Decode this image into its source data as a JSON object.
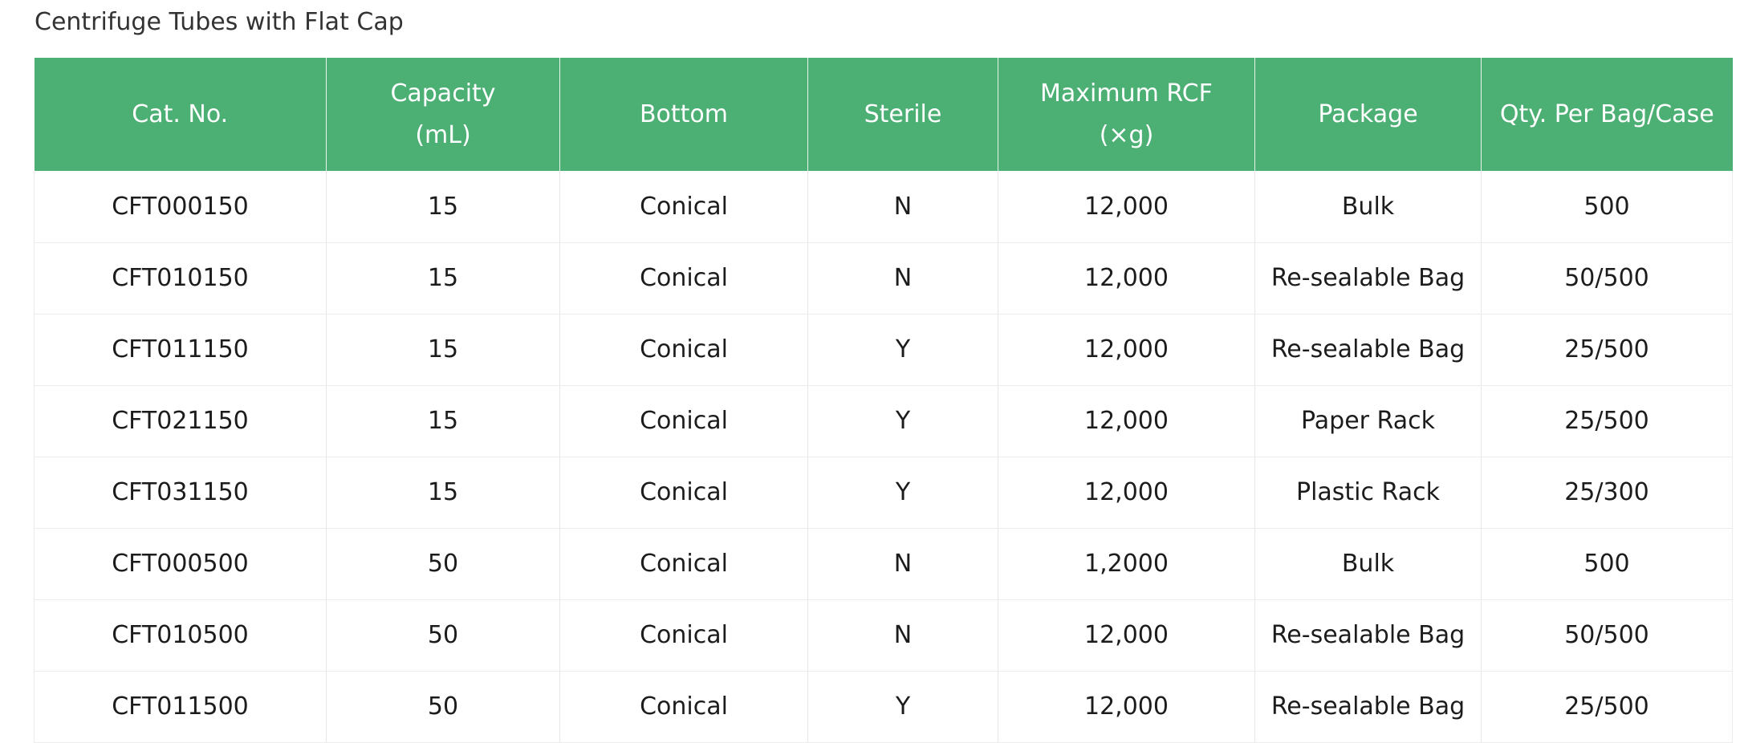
{
  "title": "Centrifuge Tubes with Flat Cap",
  "table": {
    "headers": [
      "Cat. No.",
      "Capacity\n(mL)",
      "Bottom",
      "Sterile",
      "Maximum RCF\n(×g)",
      "Package",
      "Qty. Per Bag/Case"
    ],
    "rows": [
      [
        "CFT000150",
        "15",
        "Conical",
        "N",
        "12,000",
        "Bulk",
        "500"
      ],
      [
        "CFT010150",
        "15",
        "Conical",
        "N",
        "12,000",
        "Re-sealable Bag",
        "50/500"
      ],
      [
        "CFT011150",
        "15",
        "Conical",
        "Y",
        "12,000",
        "Re-sealable Bag",
        "25/500"
      ],
      [
        "CFT021150",
        "15",
        "Conical",
        "Y",
        "12,000",
        "Paper Rack",
        "25/500"
      ],
      [
        "CFT031150",
        "15",
        "Conical",
        "Y",
        "12,000",
        "Plastic Rack",
        "25/300"
      ],
      [
        "CFT000500",
        "50",
        "Conical",
        "N",
        "1,2000",
        "Bulk",
        "500"
      ],
      [
        "CFT010500",
        "50",
        "Conical",
        "N",
        "12,000",
        "Re-sealable Bag",
        "50/500"
      ],
      [
        "CFT011500",
        "50",
        "Conical",
        "Y",
        "12,000",
        "Re-sealable Bag",
        "25/500"
      ]
    ]
  },
  "colors": {
    "header_background": "#4caf74",
    "header_text": "#ffffff",
    "grid_line": "#e6e6e6"
  }
}
